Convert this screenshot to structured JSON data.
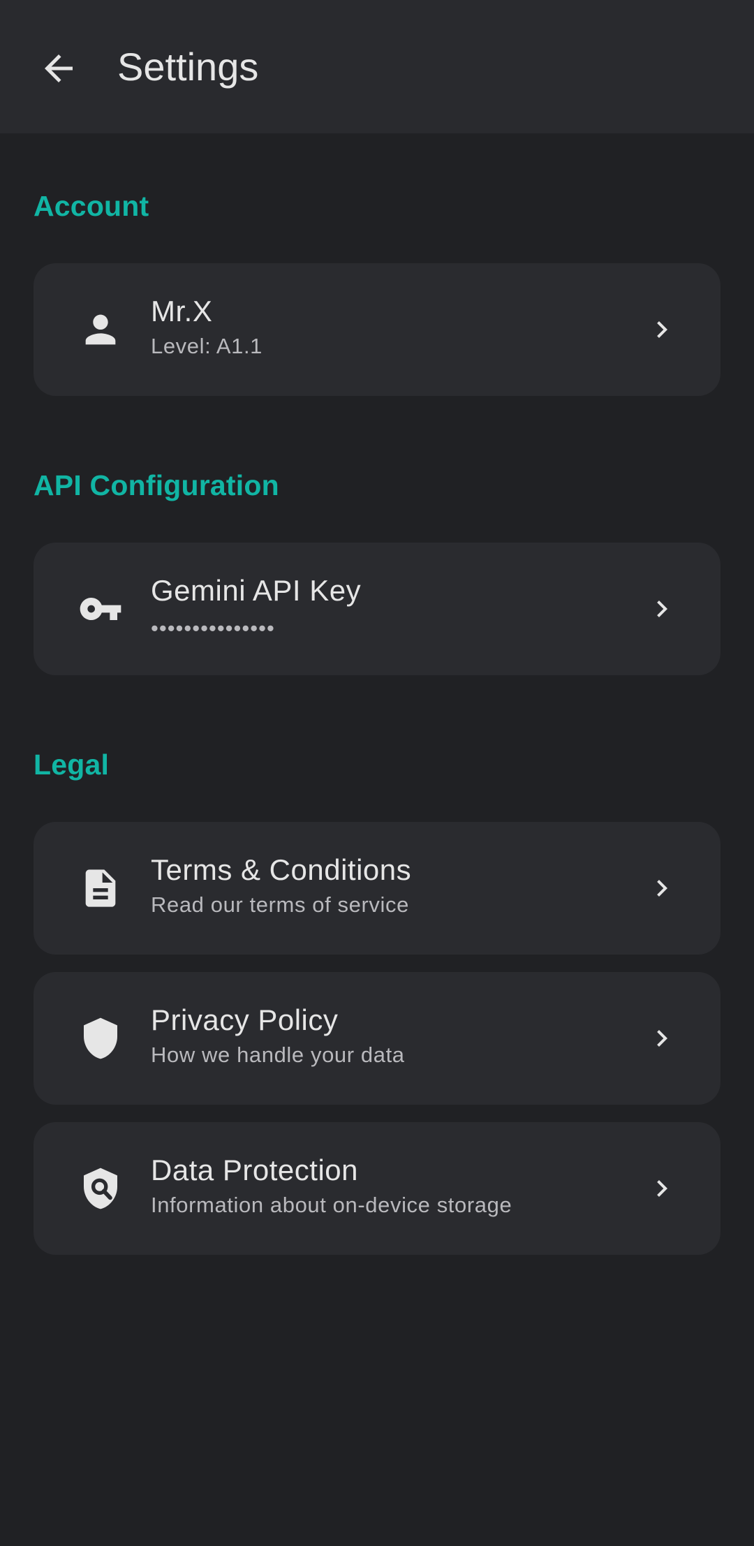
{
  "appbar": {
    "title": "Settings",
    "back_icon": "arrow-back-icon"
  },
  "sections": {
    "account": {
      "header": "Account",
      "profile": {
        "name": "Mr.X",
        "level": "Level: A1.1",
        "icon": "person-icon"
      }
    },
    "api": {
      "header": "API Configuration",
      "gemini_key": {
        "label": "Gemini API Key",
        "value": "•••••••••••••••",
        "icon": "key-icon"
      }
    },
    "legal": {
      "header": "Legal",
      "terms": {
        "label": "Terms & Conditions",
        "subtitle": "Read our terms of service",
        "icon": "document-icon"
      },
      "privacy": {
        "label": "Privacy Policy",
        "subtitle": "How we handle your data",
        "icon": "shield-icon"
      },
      "data_protection": {
        "label": "Data Protection",
        "subtitle": "Information about on-device storage",
        "icon": "shield-search-icon"
      }
    }
  },
  "colors": {
    "background": "#202124",
    "appbar": "#292a2e",
    "card": "#2a2b2f",
    "accent": "#11b5a4",
    "text_primary": "#e6e6e6",
    "text_secondary": "#b9b9bd"
  }
}
